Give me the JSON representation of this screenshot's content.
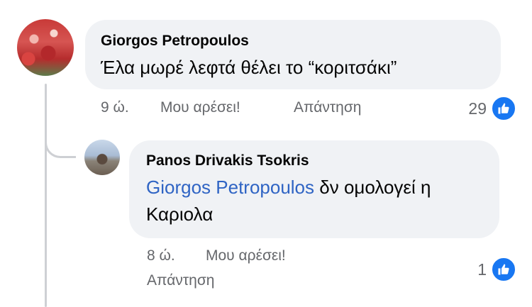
{
  "comments": [
    {
      "author": "Giorgos Petropoulos",
      "text": "Έλα μωρέ λεφτά θέλει το “κοριτσάκι”",
      "time": "9 ώ.",
      "like_label": "Μου αρέσει!",
      "reply_label": "Απάντηση",
      "reaction_count": "29",
      "reaction_icon": "thumbs-up-icon"
    }
  ],
  "reply": {
    "author": "Panos Drivakis Tsokris",
    "mention": "Giorgos Petropoulos",
    "text_rest": " δν ομολογεί η Καριολα",
    "time": "8 ώ.",
    "like_label": "Μου αρέσει!",
    "reply_label": "Απάντηση",
    "reaction_count": "1",
    "reaction_icon": "thumbs-up-icon"
  },
  "colors": {
    "like_blue": "#1877f2",
    "mention_blue": "#2f64c4",
    "bubble_bg": "#f0f2f5",
    "meta_gray": "#65676b"
  }
}
